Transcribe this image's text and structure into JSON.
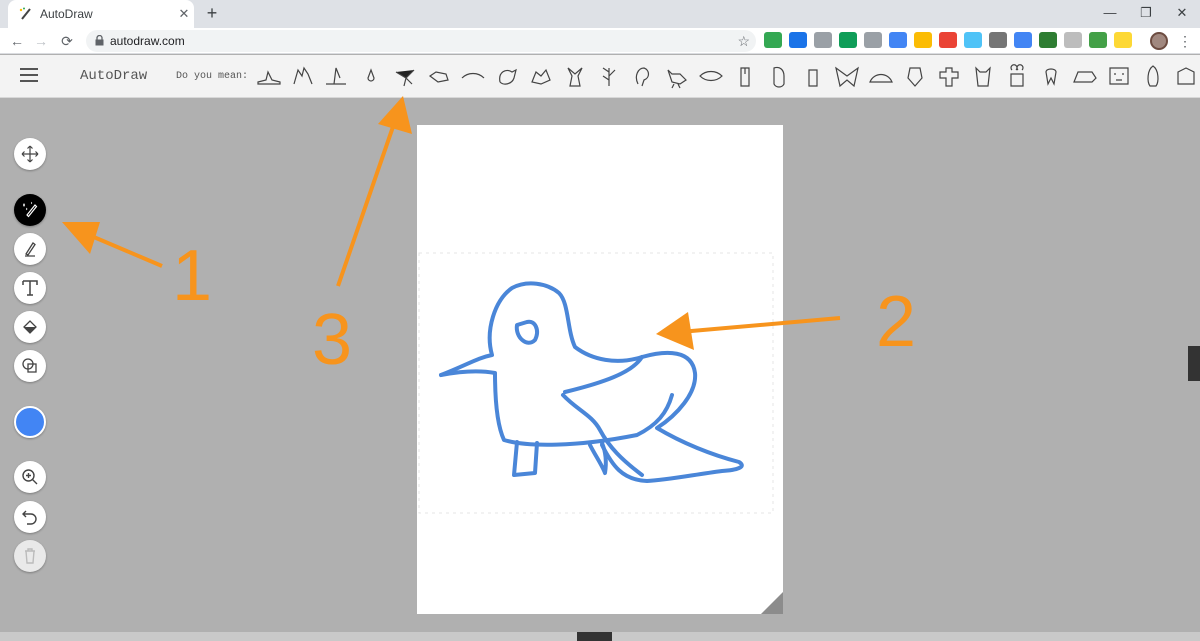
{
  "browser": {
    "tab_title": "AutoDraw",
    "tab_close": "✕",
    "new_tab": "+",
    "url": "autodraw.com",
    "window_controls": {
      "minimize": "—",
      "restore": "❐",
      "close": "✕"
    },
    "nav": {
      "back": "←",
      "forward": "→",
      "reload": "⟳",
      "star": "☆",
      "menu": "⋮"
    },
    "extension_icons": [
      "drive-icon",
      "blue-circle-icon",
      "gray-square-icon",
      "green-circle-icon",
      "camera-icon",
      "blue-window-icon",
      "chrome-icon",
      "red-badge-icon",
      "cloud-icon",
      "gray-box-icon",
      "translate-icon",
      "green-gem-icon",
      "puzzle-icon",
      "green-download-icon",
      "yellow-face-icon"
    ],
    "extension_colors": [
      "#34a853",
      "#1a73e8",
      "#9aa0a6",
      "#0f9d58",
      "#9aa0a6",
      "#4285f4",
      "#fbbc05",
      "#ea4335",
      "#4fc3f7",
      "#757575",
      "#4285f4",
      "#2e7d32",
      "#bdbdbd",
      "#43a047",
      "#fdd835"
    ]
  },
  "app": {
    "title": "AutoDraw",
    "did_you_mean_label": "Do you mean:",
    "suggestions": [
      "shoe",
      "hand",
      "boot",
      "drop",
      "bird",
      "duck",
      "wave",
      "songbird",
      "crab",
      "fox",
      "plant",
      "ear",
      "chicken",
      "eye",
      "mouse",
      "mouse",
      "mouse",
      "butterfly",
      "turtle",
      "face",
      "gingerbread-man",
      "owl",
      "teddy-bear",
      "tooth",
      "rhino",
      "lion",
      "penguin",
      "animal"
    ],
    "selected_suggestion_index": 4
  },
  "toolbar": {
    "tools": [
      "move-icon",
      "autodraw-icon",
      "pen-icon",
      "text-icon",
      "fill-icon",
      "shape-icon",
      "zoom-icon",
      "undo-icon",
      "delete-icon"
    ],
    "active_tool": "autodraw-icon",
    "stroke_color": "#4285f4"
  },
  "annotations": {
    "labels": [
      "1",
      "2",
      "3"
    ],
    "color": "#f7941d"
  }
}
